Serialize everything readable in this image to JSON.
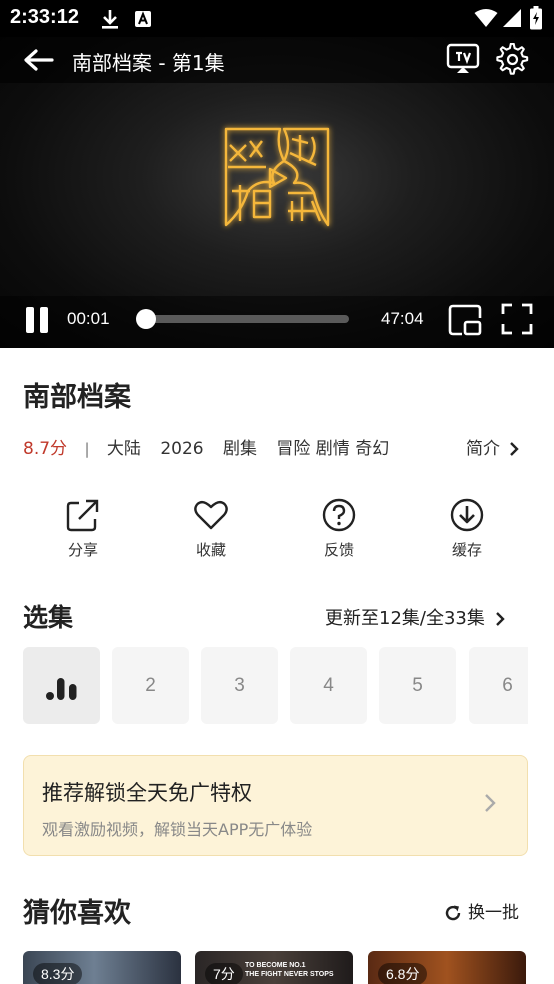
{
  "status_bar": {
    "time": "2:33:12"
  },
  "player": {
    "title": "南部档案 - 第1集",
    "current_time": "00:01",
    "total_time": "47:04",
    "progress": 0.0
  },
  "show": {
    "title": "南部档案",
    "score": "8.7分",
    "separator": "|",
    "region": "大陆",
    "year": "2026",
    "type": "剧集",
    "genres": "冒险 剧情 奇幻",
    "intro_label": "简介"
  },
  "actions": [
    {
      "label": "分享",
      "icon": "share-icon"
    },
    {
      "label": "收藏",
      "icon": "heart-icon"
    },
    {
      "label": "反馈",
      "icon": "help-icon"
    },
    {
      "label": "缓存",
      "icon": "download-icon"
    }
  ],
  "episodes": {
    "title": "选集",
    "update_label": "更新至12集/全33集",
    "items": [
      "",
      "2",
      "3",
      "4",
      "5",
      "6"
    ]
  },
  "promo": {
    "title": "推荐解锁全天免广特权",
    "subtitle": "观看激励视频，解锁当天APP无广体验"
  },
  "guess": {
    "title": "猜你喜欢",
    "refresh_label": "换一批",
    "cards": [
      {
        "score": "8.3分"
      },
      {
        "score": "7分",
        "caption": "TO BECOME NO.1\nTHE FIGHT NEVER STOPS"
      },
      {
        "score": "6.8分"
      }
    ]
  },
  "colors": {
    "score": "#c0392b",
    "promo_bg": "#fdf3d8",
    "logo_gold": "#f5b73b"
  }
}
